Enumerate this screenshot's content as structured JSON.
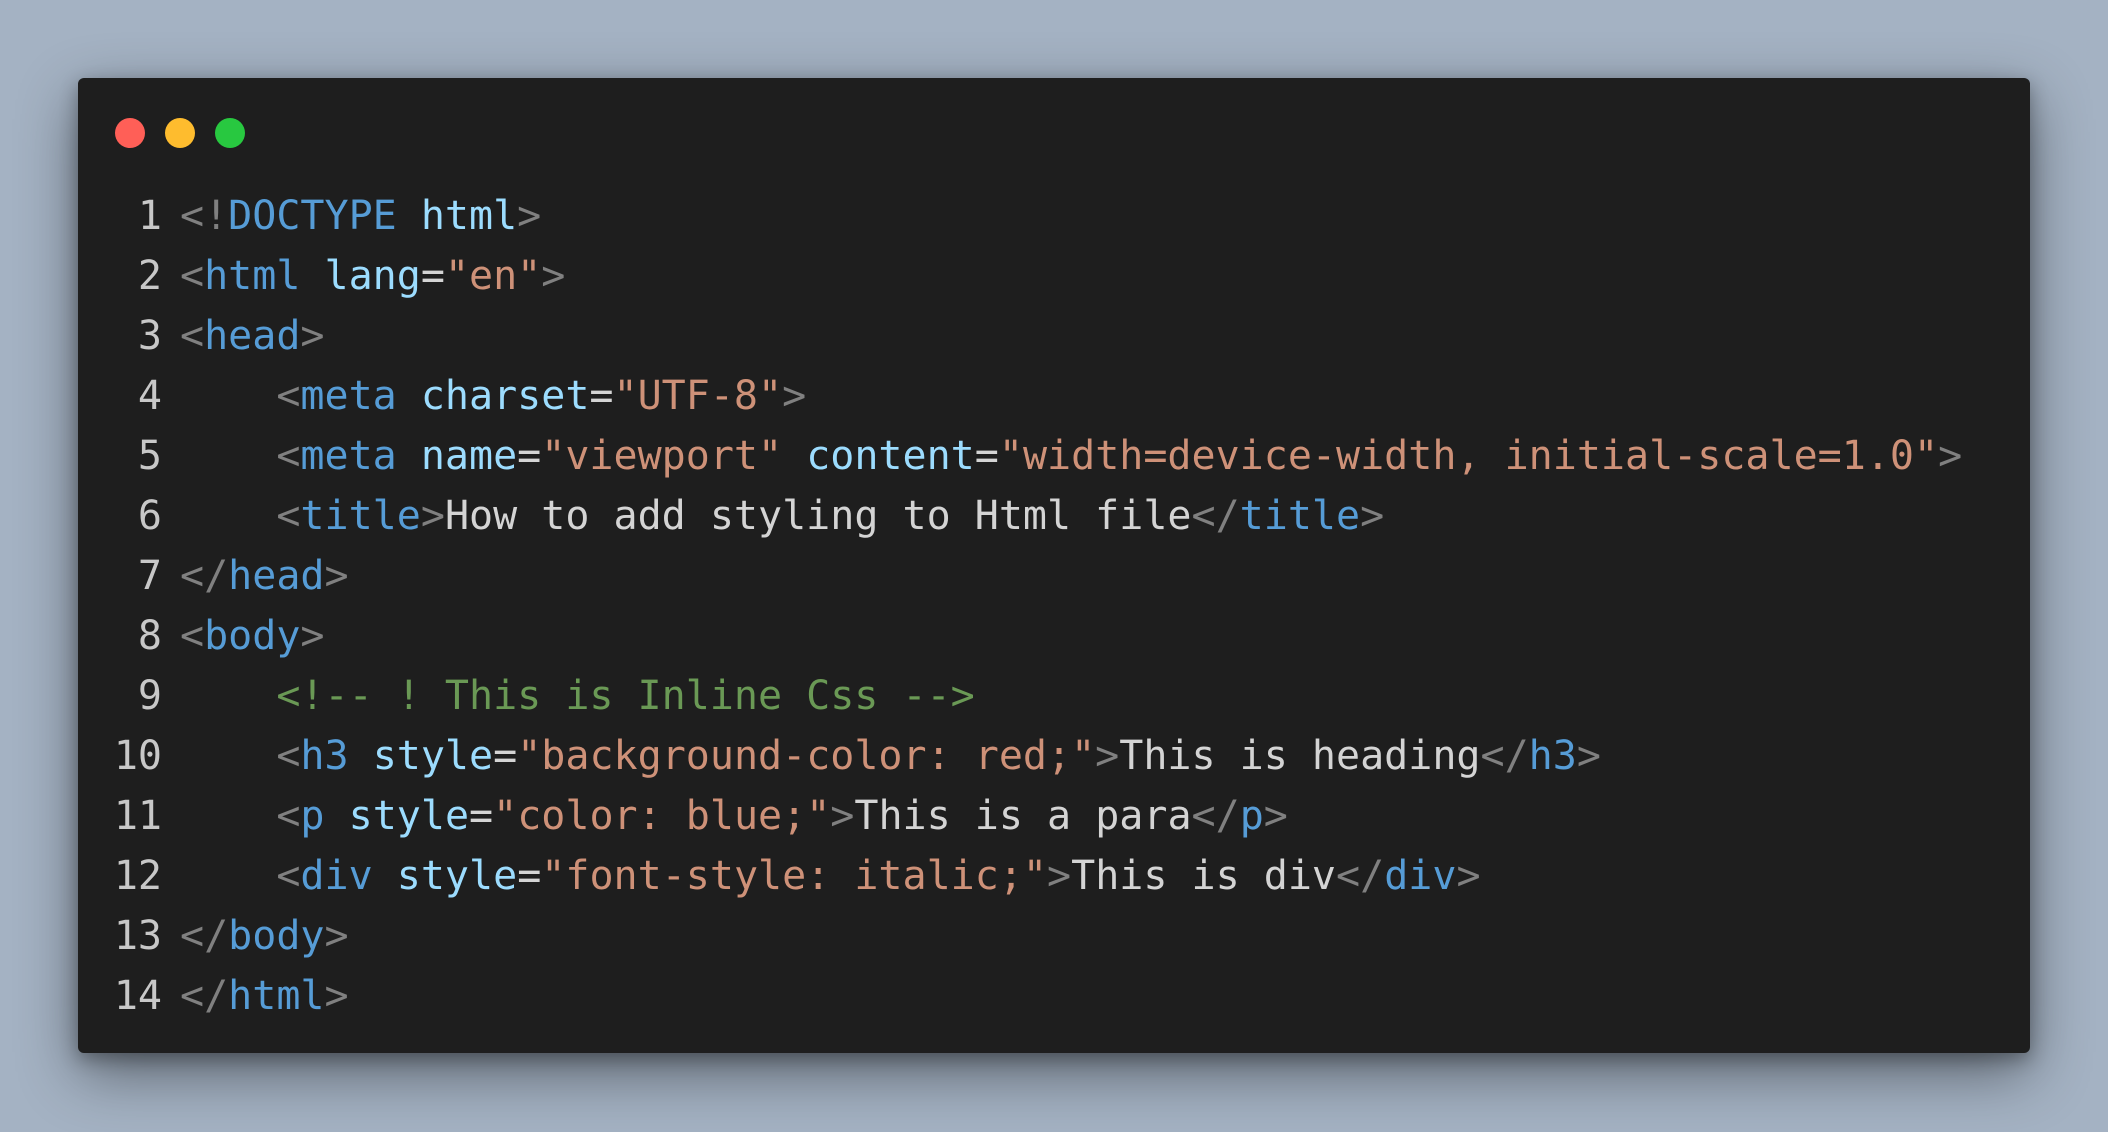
{
  "window": {
    "controls": [
      {
        "name": "close",
        "color": "#ff5f57"
      },
      {
        "name": "minimize",
        "color": "#febc2e"
      },
      {
        "name": "maximize",
        "color": "#28c840"
      }
    ]
  },
  "colors": {
    "punct": "#808080",
    "tag": "#569cd6",
    "attr": "#9cdcfe",
    "string": "#ce9178",
    "text": "#d4d4d4",
    "comment": "#6a9955",
    "background": "#1e1e1e"
  },
  "code": {
    "lines": [
      {
        "n": "1",
        "tokens": [
          {
            "t": "punct",
            "v": "<!"
          },
          {
            "t": "tag",
            "v": "DOCTYPE"
          },
          {
            "t": "space",
            "v": " "
          },
          {
            "t": "attr",
            "v": "html"
          },
          {
            "t": "punct",
            "v": ">"
          }
        ]
      },
      {
        "n": "2",
        "tokens": [
          {
            "t": "punct",
            "v": "<"
          },
          {
            "t": "tag",
            "v": "html"
          },
          {
            "t": "space",
            "v": " "
          },
          {
            "t": "attr",
            "v": "lang"
          },
          {
            "t": "eq",
            "v": "="
          },
          {
            "t": "str",
            "v": "\"en\""
          },
          {
            "t": "punct",
            "v": ">"
          }
        ]
      },
      {
        "n": "3",
        "tokens": [
          {
            "t": "punct",
            "v": "<"
          },
          {
            "t": "tag",
            "v": "head"
          },
          {
            "t": "punct",
            "v": ">"
          }
        ]
      },
      {
        "n": "4",
        "tokens": [
          {
            "t": "space",
            "v": "    "
          },
          {
            "t": "punct",
            "v": "<"
          },
          {
            "t": "tag",
            "v": "meta"
          },
          {
            "t": "space",
            "v": " "
          },
          {
            "t": "attr",
            "v": "charset"
          },
          {
            "t": "eq",
            "v": "="
          },
          {
            "t": "str",
            "v": "\"UTF-8\""
          },
          {
            "t": "punct",
            "v": ">"
          }
        ]
      },
      {
        "n": "5",
        "tokens": [
          {
            "t": "space",
            "v": "    "
          },
          {
            "t": "punct",
            "v": "<"
          },
          {
            "t": "tag",
            "v": "meta"
          },
          {
            "t": "space",
            "v": " "
          },
          {
            "t": "attr",
            "v": "name"
          },
          {
            "t": "eq",
            "v": "="
          },
          {
            "t": "str",
            "v": "\"viewport\""
          },
          {
            "t": "space",
            "v": " "
          },
          {
            "t": "attr",
            "v": "content"
          },
          {
            "t": "eq",
            "v": "="
          },
          {
            "t": "str",
            "v": "\"width=device-width, initial-scale=1.0\""
          },
          {
            "t": "punct",
            "v": ">"
          }
        ]
      },
      {
        "n": "6",
        "tokens": [
          {
            "t": "space",
            "v": "    "
          },
          {
            "t": "punct",
            "v": "<"
          },
          {
            "t": "tag",
            "v": "title"
          },
          {
            "t": "punct",
            "v": ">"
          },
          {
            "t": "text",
            "v": "How to add styling to Html file"
          },
          {
            "t": "punct",
            "v": "</"
          },
          {
            "t": "tag",
            "v": "title"
          },
          {
            "t": "punct",
            "v": ">"
          }
        ]
      },
      {
        "n": "7",
        "tokens": [
          {
            "t": "punct",
            "v": "</"
          },
          {
            "t": "tag",
            "v": "head"
          },
          {
            "t": "punct",
            "v": ">"
          }
        ]
      },
      {
        "n": "8",
        "tokens": [
          {
            "t": "punct",
            "v": "<"
          },
          {
            "t": "tag",
            "v": "body"
          },
          {
            "t": "punct",
            "v": ">"
          }
        ]
      },
      {
        "n": "9",
        "tokens": [
          {
            "t": "space",
            "v": "    "
          },
          {
            "t": "comment",
            "v": "<!-- ! This is Inline Css -->"
          }
        ]
      },
      {
        "n": "10",
        "tokens": [
          {
            "t": "space",
            "v": "    "
          },
          {
            "t": "punct",
            "v": "<"
          },
          {
            "t": "tag",
            "v": "h3"
          },
          {
            "t": "space",
            "v": " "
          },
          {
            "t": "attr",
            "v": "style"
          },
          {
            "t": "eq",
            "v": "="
          },
          {
            "t": "str",
            "v": "\"background-color: red;\""
          },
          {
            "t": "punct",
            "v": ">"
          },
          {
            "t": "text",
            "v": "This is heading"
          },
          {
            "t": "punct",
            "v": "</"
          },
          {
            "t": "tag",
            "v": "h3"
          },
          {
            "t": "punct",
            "v": ">"
          }
        ]
      },
      {
        "n": "11",
        "tokens": [
          {
            "t": "space",
            "v": "    "
          },
          {
            "t": "punct",
            "v": "<"
          },
          {
            "t": "tag",
            "v": "p"
          },
          {
            "t": "space",
            "v": " "
          },
          {
            "t": "attr",
            "v": "style"
          },
          {
            "t": "eq",
            "v": "="
          },
          {
            "t": "str",
            "v": "\"color: blue;\""
          },
          {
            "t": "punct",
            "v": ">"
          },
          {
            "t": "text",
            "v": "This is a para"
          },
          {
            "t": "punct",
            "v": "</"
          },
          {
            "t": "tag",
            "v": "p"
          },
          {
            "t": "punct",
            "v": ">"
          }
        ]
      },
      {
        "n": "12",
        "tokens": [
          {
            "t": "space",
            "v": "    "
          },
          {
            "t": "punct",
            "v": "<"
          },
          {
            "t": "tag",
            "v": "div"
          },
          {
            "t": "space",
            "v": " "
          },
          {
            "t": "attr",
            "v": "style"
          },
          {
            "t": "eq",
            "v": "="
          },
          {
            "t": "str",
            "v": "\"font-style: italic;\""
          },
          {
            "t": "punct",
            "v": ">"
          },
          {
            "t": "text",
            "v": "This is div"
          },
          {
            "t": "punct",
            "v": "</"
          },
          {
            "t": "tag",
            "v": "div"
          },
          {
            "t": "punct",
            "v": ">"
          }
        ]
      },
      {
        "n": "13",
        "tokens": [
          {
            "t": "punct",
            "v": "</"
          },
          {
            "t": "tag",
            "v": "body"
          },
          {
            "t": "punct",
            "v": ">"
          }
        ]
      },
      {
        "n": "14",
        "tokens": [
          {
            "t": "punct",
            "v": "</"
          },
          {
            "t": "tag",
            "v": "html"
          },
          {
            "t": "punct",
            "v": ">"
          }
        ]
      }
    ]
  }
}
